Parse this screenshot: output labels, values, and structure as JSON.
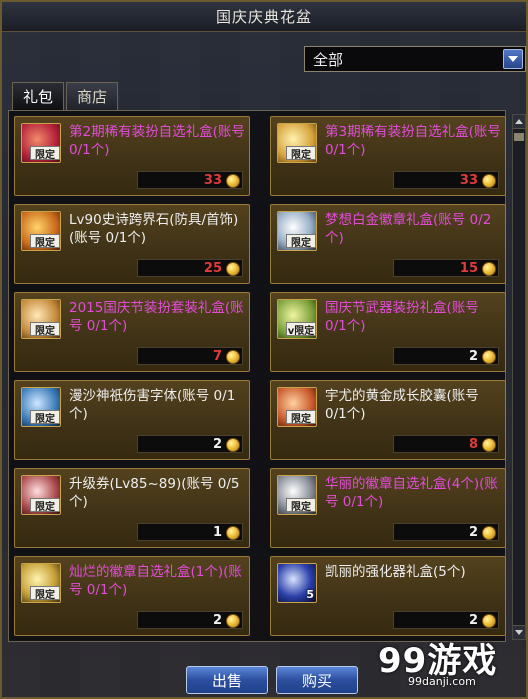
{
  "window": {
    "title": "国庆庆典花盆"
  },
  "filter": {
    "selected": "全部"
  },
  "tabs": [
    {
      "label": "礼包",
      "active": true
    },
    {
      "label": "商店",
      "active": false
    }
  ],
  "items": [
    {
      "name": "第2期稀有装扮自选礼盒(账号 0/1个)",
      "price": "33",
      "price_color": "red",
      "name_color": "magenta",
      "badge": "限定",
      "icon": "gift-box-red-icon"
    },
    {
      "name": "第3期稀有装扮自选礼盒(账号 0/1个)",
      "price": "33",
      "price_color": "red",
      "name_color": "magenta",
      "badge": "限定",
      "icon": "gift-box-gold-icon"
    },
    {
      "name": "Lv90史诗跨界石(防具/首饰)(账号 0/1个)",
      "price": "25",
      "price_color": "red",
      "name_color": "white",
      "badge": "限定",
      "icon": "epic-stone-icon"
    },
    {
      "name": "梦想白金徽章礼盒(账号 0/2个)",
      "price": "15",
      "price_color": "red",
      "name_color": "magenta",
      "badge": "限定",
      "icon": "platinum-emblem-icon"
    },
    {
      "name": "2015国庆节装扮套装礼盒(账号 0/1个)",
      "price": "7",
      "price_color": "red",
      "name_color": "magenta",
      "badge": "限定",
      "icon": "costume-box-icon"
    },
    {
      "name": "国庆节武器装扮礼盒(账号 0/1个)",
      "price": "2",
      "price_color": "white",
      "name_color": "magenta",
      "badge": "v限定",
      "icon": "weapon-box-icon"
    },
    {
      "name": "漫沙神祇伤害字体(账号 0/1个)",
      "price": "2",
      "price_color": "white",
      "name_color": "white",
      "badge": "限定",
      "icon": "damage-font-icon"
    },
    {
      "name": "宇尤的黄金成长胶囊(账号 0/1个)",
      "price": "8",
      "price_color": "red",
      "name_color": "white",
      "badge": "限定",
      "icon": "growth-capsule-icon"
    },
    {
      "name": "升级券(Lv85~89)(账号 0/5个)",
      "price": "1",
      "price_color": "white",
      "name_color": "white",
      "badge": "限定",
      "icon": "level-ticket-icon"
    },
    {
      "name": "华丽的徽章自选礼盒(4个)(账号 0/1个)",
      "price": "2",
      "price_color": "white",
      "name_color": "magenta",
      "badge": "限定",
      "icon": "emblem-box-icon"
    },
    {
      "name": "灿烂的徽章自选礼盒(1个)(账号 0/1个)",
      "price": "2",
      "price_color": "white",
      "name_color": "magenta",
      "badge": "限定",
      "icon": "brilliant-emblem-icon"
    },
    {
      "name": "凯丽的强化器礼盒(5个)",
      "price": "2",
      "price_color": "white",
      "name_color": "white",
      "badge": "5",
      "icon": "enhancer-box-icon"
    }
  ],
  "actions": {
    "sell": "出售",
    "buy": "购买"
  },
  "watermark": {
    "big": "99游戏",
    "small": "99danji.com"
  },
  "colors": {
    "accent_magenta": "#e24cd8",
    "price_red": "#e23a3a",
    "gold_border": "#9a7a3a"
  }
}
